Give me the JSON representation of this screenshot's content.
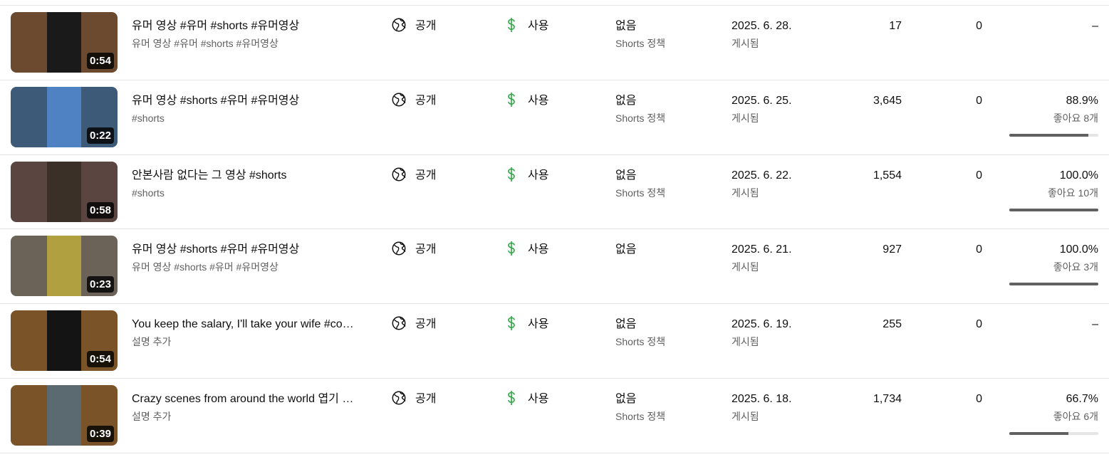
{
  "rows": [
    {
      "thumb": {
        "duration": "0:54",
        "bg": "#6b4a2f",
        "frame": "#1a1a1a"
      },
      "title": "유머 영상 #유머 #shorts #유머영상",
      "description": "유머 영상 #유머 #shorts #유머영상",
      "visibility": "공개",
      "monetization": "사용",
      "restrictions": "없음",
      "restrictions_sub": "Shorts 정책",
      "date": "2025. 6. 28.",
      "date_sub": "게시됨",
      "views": "17",
      "comments": "0",
      "likes_pct": "–",
      "likes_count": "",
      "like_ratio": null
    },
    {
      "thumb": {
        "duration": "0:22",
        "bg": "#3d5a78",
        "frame": "#4f82c2"
      },
      "title": "유머 영상 #shorts #유머 #유머영상",
      "description": "#shorts",
      "visibility": "공개",
      "monetization": "사용",
      "restrictions": "없음",
      "restrictions_sub": "Shorts 정책",
      "date": "2025. 6. 25.",
      "date_sub": "게시됨",
      "views": "3,645",
      "comments": "0",
      "likes_pct": "88.9%",
      "likes_count": "좋아요 8개",
      "like_ratio": 0.889
    },
    {
      "thumb": {
        "duration": "0:58",
        "bg": "#5a4540",
        "frame": "#3a3028"
      },
      "title": "안본사람 없다는 그 영상 #shorts",
      "description": "#shorts",
      "visibility": "공개",
      "monetization": "사용",
      "restrictions": "없음",
      "restrictions_sub": "Shorts 정책",
      "date": "2025. 6. 22.",
      "date_sub": "게시됨",
      "views": "1,554",
      "comments": "0",
      "likes_pct": "100.0%",
      "likes_count": "좋아요 10개",
      "like_ratio": 1.0
    },
    {
      "thumb": {
        "duration": "0:23",
        "bg": "#6b6258",
        "frame": "#b0a040"
      },
      "title": "유머 영상 #shorts #유머 #유머영상",
      "description": "유머 영상 #shorts #유머 #유머영상",
      "visibility": "공개",
      "monetization": "사용",
      "restrictions": "없음",
      "restrictions_sub": "",
      "date": "2025. 6. 21.",
      "date_sub": "게시됨",
      "views": "927",
      "comments": "0",
      "likes_pct": "100.0%",
      "likes_count": "좋아요 3개",
      "like_ratio": 1.0
    },
    {
      "thumb": {
        "duration": "0:54",
        "bg": "#7a5428",
        "frame": "#141414"
      },
      "title": "You keep the salary, I'll take your wife #comedy",
      "description": "설명 추가",
      "visibility": "공개",
      "monetization": "사용",
      "restrictions": "없음",
      "restrictions_sub": "Shorts 정책",
      "date": "2025. 6. 19.",
      "date_sub": "게시됨",
      "views": "255",
      "comments": "0",
      "likes_pct": "–",
      "likes_count": "",
      "like_ratio": null
    },
    {
      "thumb": {
        "duration": "0:39",
        "bg": "#7a5428",
        "frame": "#5a6a70"
      },
      "title": "Crazy scenes from around the world 엽기 영상",
      "description": "설명 추가",
      "visibility": "공개",
      "monetization": "사용",
      "restrictions": "없음",
      "restrictions_sub": "Shorts 정책",
      "date": "2025. 6. 18.",
      "date_sub": "게시됨",
      "views": "1,734",
      "comments": "0",
      "likes_pct": "66.7%",
      "likes_count": "좋아요 6개",
      "like_ratio": 0.667
    }
  ],
  "icons": {
    "visibility": "globe-icon",
    "monetization": "dollar-icon"
  },
  "colors": {
    "monetization_green": "#2ba640",
    "secondary_text": "#606060",
    "divider": "#e5e5e5"
  }
}
